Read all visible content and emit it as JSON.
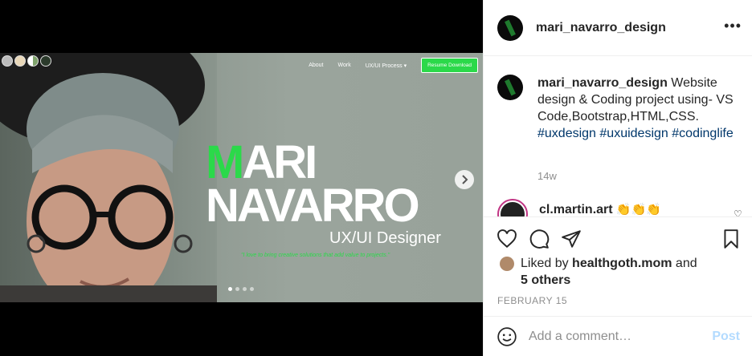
{
  "post": {
    "media": {
      "site": {
        "nav": [
          "About",
          "Work",
          "UX/UI Process ▾"
        ],
        "resume_button": "Resume Download",
        "hero_first_accent": "M",
        "hero_first_rest": "ARI",
        "hero_last": "NAVARRO",
        "hero_role": "UX/UI Designer",
        "hero_tagline": "\"I love to bring creative solutions that add value to projects.\""
      },
      "carousel": {
        "slide_count": 4,
        "active_index": 0
      },
      "accent_color": "#2bd94a"
    },
    "header": {
      "username": "mari_navarro_design",
      "more_icon": "more-horizontal-icon"
    },
    "caption": {
      "username": "mari_navarro_design",
      "text": " Website design & Coding project using- VS Code,Bootstrap,HTML,CSS. ",
      "hashtags": [
        "#uxdesign",
        "#uxuidesign",
        "#codinglife"
      ],
      "time": "14w"
    },
    "comment": {
      "username": "cl.martin.art",
      "emoji": " 👏👏👏"
    },
    "likes": {
      "prefix": "Liked by ",
      "user": "healthgoth.mom",
      "and": " and",
      "others": "5 others"
    },
    "date": "FEBRUARY 15",
    "add_comment": {
      "placeholder": "Add a comment…",
      "post_label": "Post"
    }
  }
}
